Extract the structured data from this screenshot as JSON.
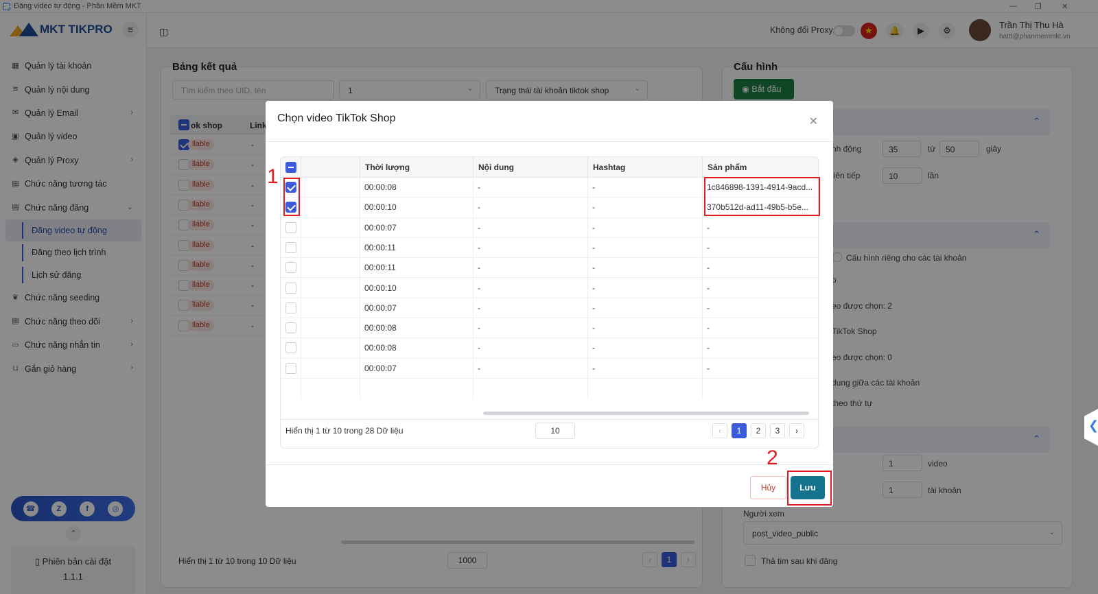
{
  "window": {
    "title": "Đăng video tự động - Phần Mềm MKT"
  },
  "sidebar": {
    "logo": "MKT TIKPRO",
    "items": [
      {
        "label": "Quản lý tài khoản",
        "icon": "grid-icon",
        "chevron": false
      },
      {
        "label": "Quản lý nội dung",
        "icon": "content-icon",
        "chevron": false
      },
      {
        "label": "Quản lý Email",
        "icon": "mail-icon",
        "chevron": true
      },
      {
        "label": "Quản lý video",
        "icon": "video-icon",
        "chevron": false
      },
      {
        "label": "Quản lý Proxy",
        "icon": "layers-icon",
        "chevron": true
      },
      {
        "label": "Chức năng tương tác",
        "icon": "interact-icon",
        "chevron": false
      },
      {
        "label": "Chức năng đăng",
        "icon": "post-icon",
        "chevron": "down"
      }
    ],
    "subitems": [
      {
        "label": "Đăng video tự động",
        "active": true
      },
      {
        "label": "Đăng theo lịch trình",
        "active": false
      },
      {
        "label": "Lịch sử đăng",
        "active": false
      }
    ],
    "items2": [
      {
        "label": "Chức năng seeding",
        "icon": "seeding-icon",
        "chevron": false
      },
      {
        "label": "Chức năng theo dõi",
        "icon": "follow-icon",
        "chevron": true
      },
      {
        "label": "Chức năng nhắn tin",
        "icon": "chat-icon",
        "chevron": true
      },
      {
        "label": "Gắn giỏ hàng",
        "icon": "cart-icon",
        "chevron": true
      }
    ],
    "version_label": "Phiên bản cài đặt",
    "version": "1.1.1"
  },
  "header": {
    "proxy_label": "Không đổi Proxy",
    "user_name": "Trần Thị Thu Hà",
    "user_email": "hattt@phanmemmkt.vn"
  },
  "results": {
    "title": "Bảng kết quả",
    "search_placeholder": "Tìm kiếm theo UID, tên",
    "select_value": "1",
    "status_placeholder": "Trạng thái tài khoản tiktok shop",
    "col_shop": "ok shop",
    "col_link": "Link",
    "badge": "llable",
    "dash": "-",
    "footer_info": "Hiển thị 1 từ 10 trong 10 Dữ liệu",
    "page_size": "1000",
    "page": "1"
  },
  "config": {
    "title": "Cấu hình",
    "start_button": "Bắt đầu",
    "l1": "nh động",
    "v1a": "35",
    "mid1": "từ",
    "v1b": "50",
    "unit1": "giây",
    "l2": "liên tiếp",
    "v2": "10",
    "unit2": "lần",
    "radio_label": "Cấu hình riêng cho các tài khoản",
    "t1": "p",
    "t2": "eo được chọn: 2",
    "t3": "TikTok Shop",
    "t4": "eo được chọn: 0",
    "t5": "dung giữa các tài khoản",
    "t6": "theo thứ tự",
    "v3": "1",
    "unit3": "video",
    "v4": "1",
    "unit4": "tài khoản",
    "viewer_label": "Người xem",
    "viewer_value": "post_video_public",
    "heart_label": "Thả tim sau khi đăng"
  },
  "modal": {
    "title": "Chọn video TikTok Shop",
    "columns": [
      "Thời lượng",
      "Nội dung",
      "Hashtag",
      "Sản phẩm"
    ],
    "rows": [
      {
        "checked": true,
        "duration": "00:00:08",
        "content": "-",
        "hashtag": "-",
        "product": "1c846898-1391-4914-9acd..."
      },
      {
        "checked": true,
        "duration": "00:00:10",
        "content": "-",
        "hashtag": "-",
        "product": "370b512d-ad11-49b5-b5e..."
      },
      {
        "checked": false,
        "duration": "00:00:07",
        "content": "-",
        "hashtag": "-",
        "product": "-"
      },
      {
        "checked": false,
        "duration": "00:00:11",
        "content": "-",
        "hashtag": "-",
        "product": "-"
      },
      {
        "checked": false,
        "duration": "00:00:11",
        "content": "-",
        "hashtag": "-",
        "product": "-"
      },
      {
        "checked": false,
        "duration": "00:00:10",
        "content": "-",
        "hashtag": "-",
        "product": "-"
      },
      {
        "checked": false,
        "duration": "00:00:07",
        "content": "-",
        "hashtag": "-",
        "product": "-"
      },
      {
        "checked": false,
        "duration": "00:00:08",
        "content": "-",
        "hashtag": "-",
        "product": "-"
      },
      {
        "checked": false,
        "duration": "00:00:08",
        "content": "-",
        "hashtag": "-",
        "product": "-"
      },
      {
        "checked": false,
        "duration": "00:00:07",
        "content": "-",
        "hashtag": "-",
        "product": "-"
      }
    ],
    "footer_info": "Hiển thị 1 từ 10 trong 28 Dữ liệu",
    "page_size": "10",
    "pages": [
      "1",
      "2",
      "3"
    ],
    "current_page": "1",
    "cancel": "Hủy",
    "save": "Lưu"
  },
  "annotations": {
    "one": "1",
    "two": "2"
  },
  "colors": {
    "accent": "#3b5bdb",
    "save": "#16738f",
    "start": "#1e7e45",
    "highlight": "#e31b23"
  }
}
